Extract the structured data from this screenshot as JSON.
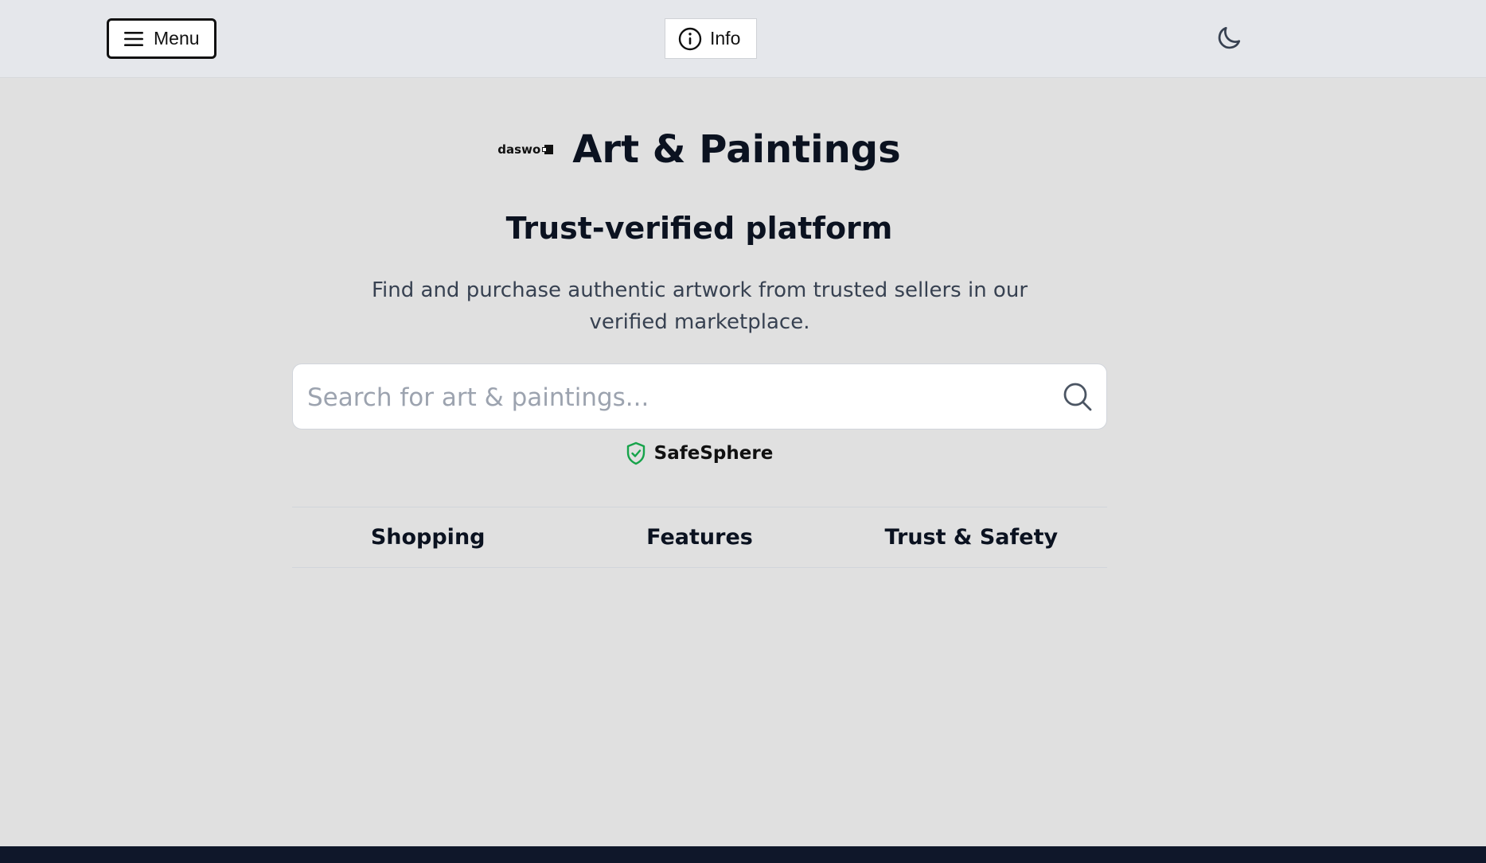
{
  "header": {
    "menu_label": "Menu",
    "info_label": "Info",
    "icons": {
      "menu": "hamburger-icon",
      "info": "info-circle-icon",
      "theme": "moon-icon"
    }
  },
  "hero": {
    "logo_text": "daswo",
    "title": "Art & Paintings",
    "subtitle": "Trust-verified platform",
    "description": "Find and purchase authentic artwork from trusted sellers in our verified marketplace."
  },
  "search": {
    "value": "",
    "placeholder": "Search for art & paintings...",
    "icon": "search-icon"
  },
  "badge": {
    "label": "SafeSphere",
    "icon": "shield-check-icon",
    "color": "#16a34a"
  },
  "tabs": [
    {
      "label": "Shopping"
    },
    {
      "label": "Features"
    },
    {
      "label": "Trust & Safety"
    }
  ],
  "colors": {
    "background": "#e0e0e0",
    "topbar": "#e5e7eb",
    "footer": "#0f172a"
  }
}
